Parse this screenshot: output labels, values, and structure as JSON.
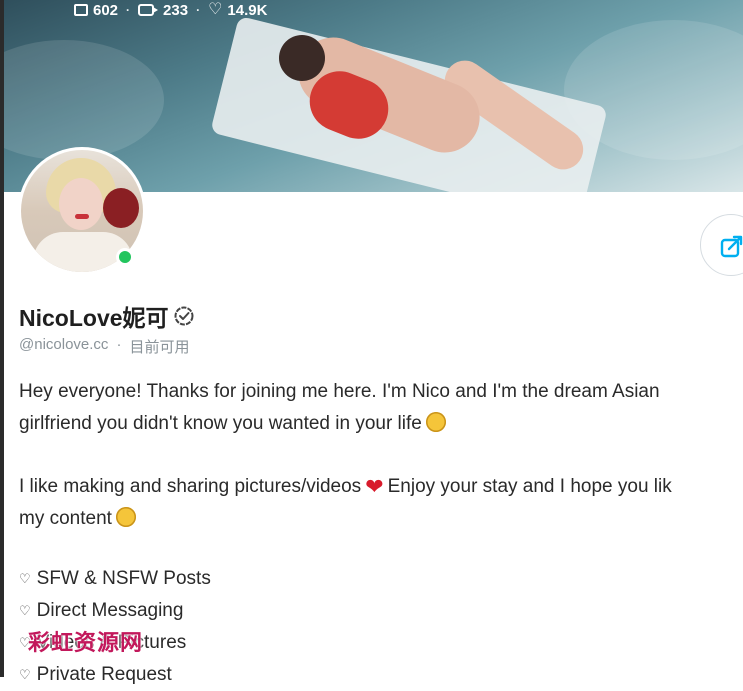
{
  "stats": {
    "images": "602",
    "videos": "233",
    "likes": "14.9K",
    "separator": "·"
  },
  "profile": {
    "display_name": "NicoLove妮可",
    "handle": "@nicolove.cc",
    "status_separator": "·",
    "status": "目前可用",
    "online_color": "#22c55e"
  },
  "bio": {
    "line1": "Hey everyone! Thanks for joining me here. I'm Nico and I'm the dream Asian",
    "line2": "girlfriend you didn't know you wanted in your life",
    "line3a": "I like making and sharing pictures/videos",
    "line3b": "Enjoy your stay and I hope you lik",
    "line4": "my content"
  },
  "features": [
    {
      "label": "SFW & NSFW Posts"
    },
    {
      "label": "Direct Messaging"
    },
    {
      "label": "Videos & Pictures"
    },
    {
      "label": "Private Request"
    }
  ],
  "watermark": "彩虹资源网",
  "icons": {
    "images": "image-icon",
    "videos": "video-icon",
    "likes": "heart-icon",
    "share": "share-icon",
    "verified": "verified-icon"
  },
  "colors": {
    "accent": "#00aff0",
    "heart_emoji": "#d81b2c",
    "watermark": "#c2185b"
  }
}
